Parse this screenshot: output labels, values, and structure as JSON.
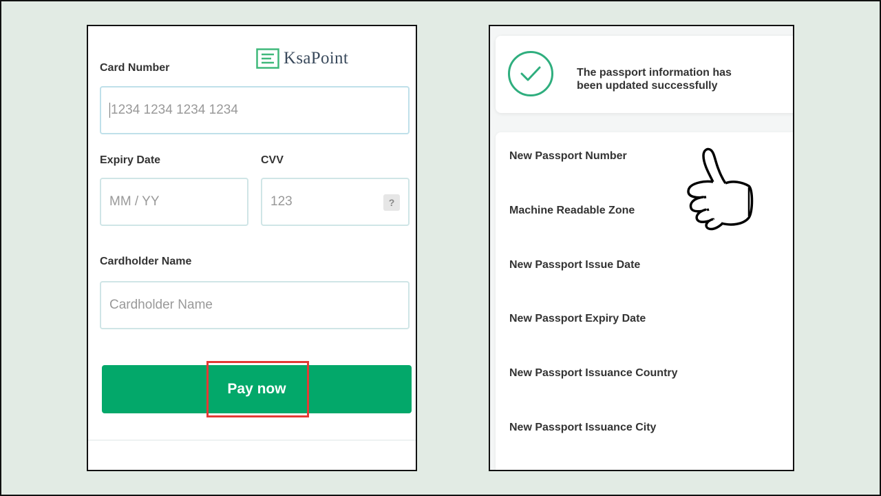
{
  "logo": {
    "text": "KsaPoint",
    "icon": "list-document-icon"
  },
  "payment_form": {
    "card_number": {
      "label": "Card Number",
      "placeholder": "1234 1234 1234 1234"
    },
    "expiry": {
      "label": "Expiry Date",
      "placeholder": "MM / YY"
    },
    "cvv": {
      "label": "CVV",
      "placeholder": "123",
      "help_icon": "?"
    },
    "cardholder": {
      "label": "Cardholder Name",
      "placeholder": "Cardholder Name"
    },
    "pay_button_label": "Pay now"
  },
  "passport_result": {
    "success_message": "The passport information has been updated successfully",
    "fields": [
      "New Passport Number",
      "Machine Readable Zone",
      "New Passport Issue Date",
      "New Passport Expiry Date",
      "New Passport Issuance Country",
      "New Passport Issuance City"
    ]
  },
  "colors": {
    "background": "#e2ebe4",
    "pay_button": "#03a86a",
    "highlight": "#e53935",
    "success_check": "#2fae7e",
    "logo_icon": "#3fb87a"
  }
}
